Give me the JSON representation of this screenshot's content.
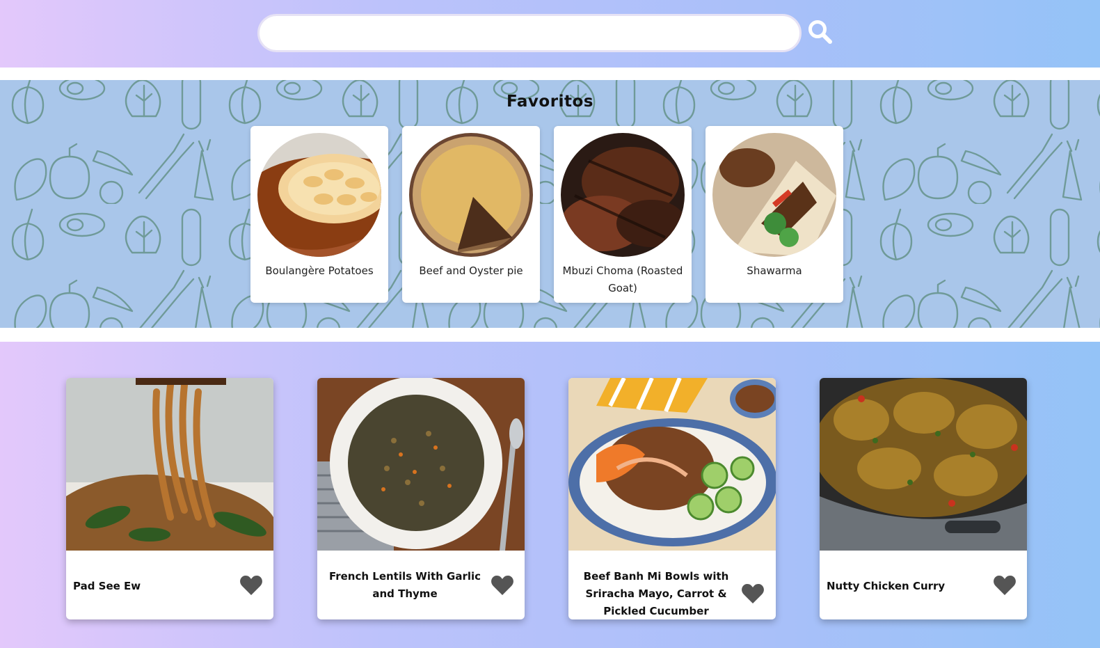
{
  "search": {
    "placeholder": "",
    "value": ""
  },
  "favorites": {
    "title": "Favoritos",
    "items": [
      {
        "name": "Boulangère Potatoes"
      },
      {
        "name": "Beef and Oyster pie"
      },
      {
        "name": "Mbuzi Choma (Roasted Goat)"
      },
      {
        "name": "Shawarma"
      }
    ]
  },
  "recipes": [
    {
      "title": "Pad See Ew"
    },
    {
      "title": "French Lentils With Garlic and Thyme"
    },
    {
      "title": "Beef Banh Mi Bowls with Sriracha Mayo, Carrot & Pickled Cucumber"
    },
    {
      "title": "Nutty Chicken Curry"
    }
  ],
  "colors": {
    "band": "#a9c6ea",
    "doodle": "#6f9a98",
    "heart": "#555555"
  }
}
